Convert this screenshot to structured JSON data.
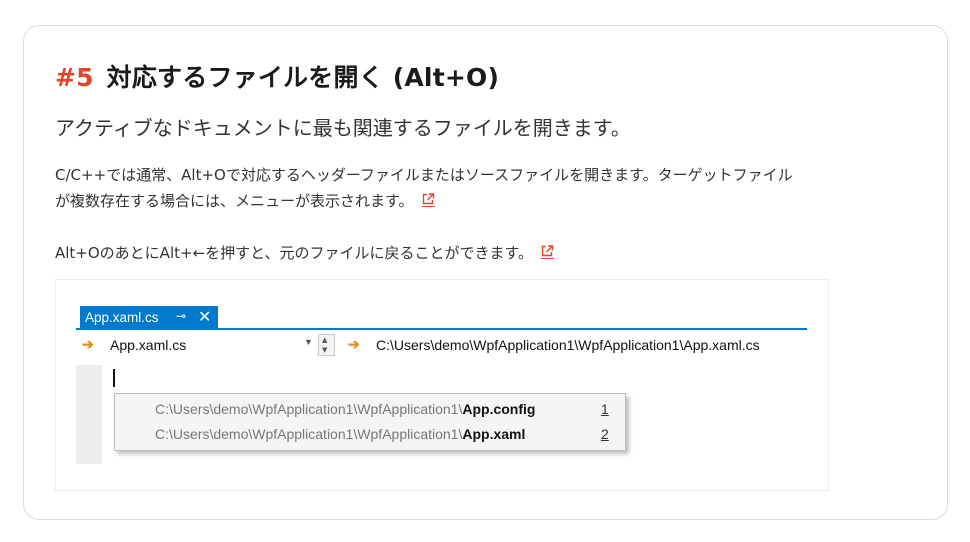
{
  "heading": {
    "number": "#5",
    "title": "対応するファイルを開く (Alt+O)"
  },
  "subtitle": "アクティブなドキュメントに最も関連するファイルを開きます。",
  "paragraphs": {
    "p1_line1": "C/C++では通常、Alt+Oで対応するヘッダーファイルまたはソースファイルを開きます。ターゲットファイル",
    "p1_line2": "が複数存在する場合には、メニューが表示されます。",
    "p2": "Alt+OのあとにAlt+←を押すと、元のファイルに戻ることができます。"
  },
  "icons": {
    "external_link": "external-link-icon",
    "pin": "pin-icon",
    "close": "close-icon",
    "nav_arrow": "arrow-right-icon"
  },
  "colors": {
    "accent": "#e0452a",
    "vs_blue": "#007acc",
    "nav_arrow": "#e2901a"
  },
  "screenshot": {
    "tab": {
      "label": "App.xaml.cs",
      "pin_glyph": "⊸",
      "close_glyph": "✕"
    },
    "nav": {
      "arrow_glyph": "➔",
      "left_value": "App.xaml.cs",
      "right_value": "C:\\Users\\demo\\WpfApplication1\\WpfApplication1\\App.xaml.cs"
    },
    "popup_items": [
      {
        "path": "C:\\Users\\demo\\WpfApplication1\\WpfApplication1\\",
        "file": "App.config",
        "index": "1"
      },
      {
        "path": "C:\\Users\\demo\\WpfApplication1\\WpfApplication1\\",
        "file": "App.xaml",
        "index": "2"
      }
    ]
  }
}
